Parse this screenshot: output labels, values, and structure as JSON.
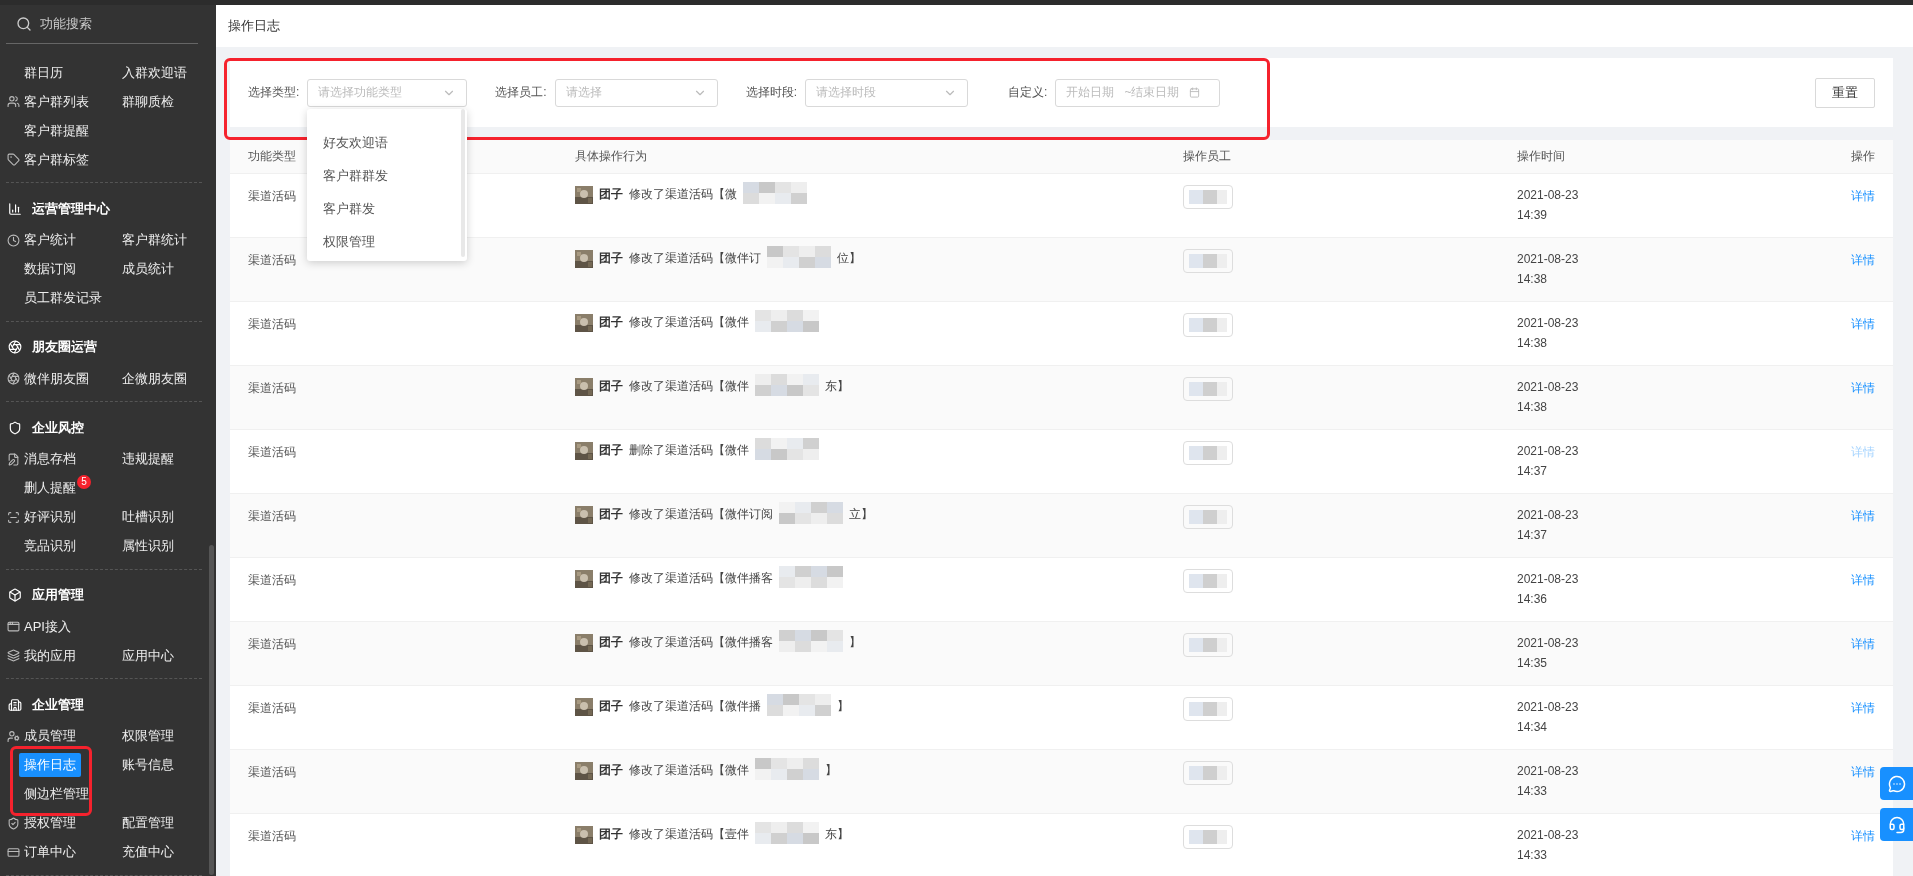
{
  "sidebar": {
    "search_placeholder": "功能搜索",
    "sections": [
      {
        "rows": [
          {
            "items": [
              {
                "label": "群日历",
                "selected": false
              },
              {
                "label": "入群欢迎语",
                "selected": false
              }
            ]
          },
          {
            "items": [
              {
                "label": "客户群列表",
                "selected": false
              },
              {
                "label": "群聊质检",
                "selected": false
              }
            ]
          },
          {
            "items": [
              {
                "label": "客户群提醒",
                "selected": false
              }
            ]
          },
          {
            "items": [
              {
                "label": "客户群标签",
                "selected": false
              }
            ]
          }
        ]
      },
      {
        "title": "运营管理中心",
        "rows": [
          {
            "items": [
              {
                "label": "客户统计",
                "selected": false
              },
              {
                "label": "客户群统计",
                "selected": false
              }
            ]
          },
          {
            "items": [
              {
                "label": "数据订阅",
                "selected": false
              },
              {
                "label": "成员统计",
                "selected": false
              }
            ]
          },
          {
            "items": [
              {
                "label": "员工群发记录",
                "selected": false
              }
            ]
          }
        ]
      },
      {
        "title": "朋友圈运营",
        "rows": [
          {
            "items": [
              {
                "label": "微伴朋友圈",
                "selected": false
              },
              {
                "label": "企微朋友圈",
                "selected": false
              }
            ]
          }
        ]
      },
      {
        "title": "企业风控",
        "rows": [
          {
            "items": [
              {
                "label": "消息存档",
                "selected": false
              },
              {
                "label": "违规提醒",
                "selected": false
              }
            ]
          },
          {
            "items": [
              {
                "label": "删人提醒",
                "selected": false,
                "badge": "5"
              }
            ]
          },
          {
            "items": [
              {
                "label": "好评识别",
                "selected": false
              },
              {
                "label": "吐槽识别",
                "selected": false
              }
            ]
          },
          {
            "items": [
              {
                "label": "竞品识别",
                "selected": false
              },
              {
                "label": "属性识别",
                "selected": false
              }
            ]
          }
        ]
      },
      {
        "title": "应用管理",
        "rows": [
          {
            "items": [
              {
                "label": "API接入",
                "selected": false
              }
            ]
          },
          {
            "items": [
              {
                "label": "我的应用",
                "selected": false
              },
              {
                "label": "应用中心",
                "selected": false
              }
            ]
          }
        ]
      },
      {
        "title": "企业管理",
        "rows": [
          {
            "items": [
              {
                "label": "成员管理",
                "selected": false
              },
              {
                "label": "权限管理",
                "selected": false
              }
            ]
          },
          {
            "items": [
              {
                "label": "操作日志",
                "selected": true
              },
              {
                "label": "账号信息",
                "selected": false
              }
            ]
          },
          {
            "items": [
              {
                "label": "侧边栏管理",
                "selected": false
              }
            ]
          },
          {
            "items": [
              {
                "label": "授权管理",
                "selected": false
              },
              {
                "label": "配置管理",
                "selected": false
              }
            ]
          },
          {
            "items": [
              {
                "label": "订单中心",
                "selected": false
              },
              {
                "label": "充值中心",
                "selected": false
              }
            ]
          }
        ]
      }
    ]
  },
  "page_title": "操作日志",
  "filters": {
    "type": {
      "label": "选择类型:",
      "placeholder": "请选择功能类型",
      "open": true,
      "options": [
        {
          "label": "好友欢迎语",
          "selected": false
        },
        {
          "label": "客户群群发",
          "selected": false
        },
        {
          "label": "客户群发",
          "selected": false
        },
        {
          "label": "权限管理",
          "selected": false
        }
      ]
    },
    "employee": {
      "label": "选择员工:",
      "placeholder": "请选择"
    },
    "period": {
      "label": "选择时段:",
      "placeholder": "请选择时段"
    },
    "custom": {
      "label": "自定义:",
      "start_placeholder": "开始日期",
      "separator": "~",
      "end_placeholder": "结束日期"
    },
    "reset_button": "重置"
  },
  "table": {
    "columns": [
      "功能类型",
      "具体操作行为",
      "操作员工",
      "操作时间",
      "操作"
    ],
    "rows": [
      {
        "type": "渠道活码",
        "user": "团子",
        "action": "修改了渠道活码【微",
        "suffix": "",
        "date": "2021-08-23",
        "time": "14:39",
        "link": "详情",
        "disabled": false
      },
      {
        "type": "渠道活码",
        "user": "团子",
        "action": "修改了渠道活码【微伴订",
        "suffix": "位】",
        "date": "2021-08-23",
        "time": "14:38",
        "link": "详情",
        "disabled": false
      },
      {
        "type": "渠道活码",
        "user": "团子",
        "action": "修改了渠道活码【微伴",
        "suffix": "",
        "date": "2021-08-23",
        "time": "14:38",
        "link": "详情",
        "disabled": false
      },
      {
        "type": "渠道活码",
        "user": "团子",
        "action": "修改了渠道活码【微伴",
        "suffix": "东】",
        "date": "2021-08-23",
        "time": "14:38",
        "link": "详情",
        "disabled": false
      },
      {
        "type": "渠道活码",
        "user": "团子",
        "action": "删除了渠道活码【微伴",
        "suffix": "",
        "date": "2021-08-23",
        "time": "14:37",
        "link": "详情",
        "disabled": true
      },
      {
        "type": "渠道活码",
        "user": "团子",
        "action": "修改了渠道活码【微伴订阅",
        "suffix": "立】",
        "date": "2021-08-23",
        "time": "14:37",
        "link": "详情",
        "disabled": false
      },
      {
        "type": "渠道活码",
        "user": "团子",
        "action": "修改了渠道活码【微伴播客",
        "suffix": "",
        "date": "2021-08-23",
        "time": "14:36",
        "link": "详情",
        "disabled": false
      },
      {
        "type": "渠道活码",
        "user": "团子",
        "action": "修改了渠道活码【微伴播客",
        "suffix": "】",
        "date": "2021-08-23",
        "time": "14:35",
        "link": "详情",
        "disabled": false
      },
      {
        "type": "渠道活码",
        "user": "团子",
        "action": "修改了渠道活码【微伴播",
        "suffix": "】",
        "date": "2021-08-23",
        "time": "14:34",
        "link": "详情",
        "disabled": false
      },
      {
        "type": "渠道活码",
        "user": "团子",
        "action": "修改了渠道活码【微伴",
        "suffix": "】",
        "date": "2021-08-23",
        "time": "14:33",
        "link": "详情",
        "disabled": false
      },
      {
        "type": "渠道活码",
        "user": "团子",
        "action": "修改了渠道活码【壹伴",
        "suffix": "东】",
        "date": "2021-08-23",
        "time": "14:33",
        "link": "详情",
        "disabled": false
      }
    ]
  }
}
